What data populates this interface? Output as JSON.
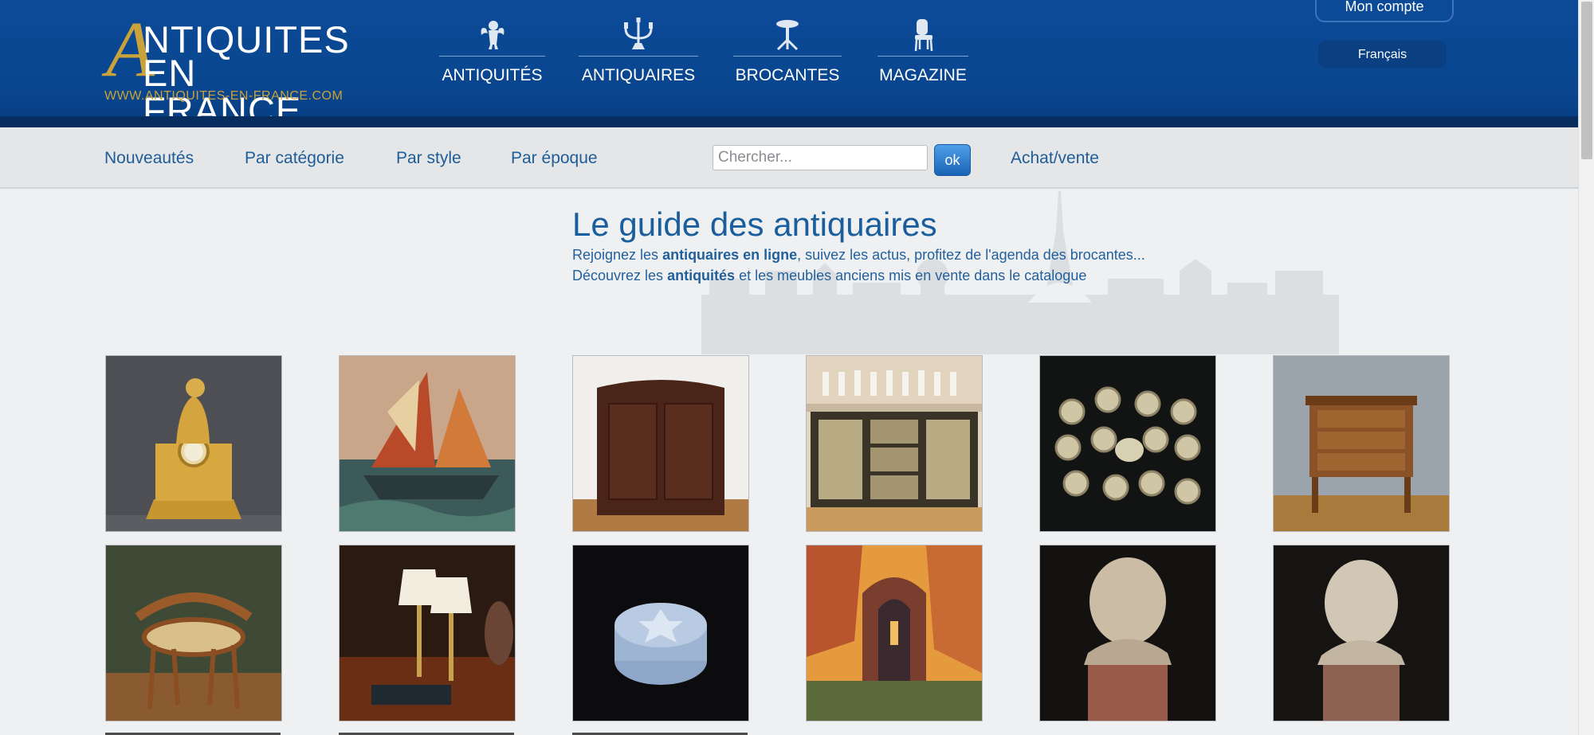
{
  "logo": {
    "big_letter": "A",
    "line1": "NTIQUITES",
    "line2": "EN FRANCE",
    "url": "WWW.ANTIQUITES-EN-FRANCE.COM"
  },
  "main_nav": [
    {
      "label": "ANTIQUITÉS",
      "icon": "cherub-icon"
    },
    {
      "label": "ANTIQUAIRES",
      "icon": "candelabra-icon"
    },
    {
      "label": "BROCANTES",
      "icon": "pedestal-table-icon"
    },
    {
      "label": "MAGAZINE",
      "icon": "chair-icon"
    }
  ],
  "account": {
    "label": "Mon compte"
  },
  "language": {
    "label": "Français"
  },
  "subnav": {
    "links": [
      "Nouveautés",
      "Par catégorie",
      "Par style",
      "Par époque"
    ],
    "search_placeholder": "Chercher...",
    "search_button": "ok",
    "achat_vente": "Achat/vente"
  },
  "hero": {
    "title": "Le guide des antiquaires",
    "line1_pre": "Rejoignez les ",
    "line1_bold": "antiquaires en ligne",
    "line1_post": ", suivez les actus, profitez de l'agenda des brocantes...",
    "line2_pre": "Découvrez les ",
    "line2_bold": "antiquités",
    "line2_post": " et les meubles anciens mis en vente dans le catalogue"
  },
  "colors": {
    "header_blue": "#0c4a98",
    "gold": "#c9a23b",
    "link_blue": "#1f5d99"
  },
  "products": [
    {
      "name": "gilt-bronze-clock"
    },
    {
      "name": "sailboat-painting"
    },
    {
      "name": "walnut-corner-cabinet"
    },
    {
      "name": "crystal-glass-set-on-cabinet"
    },
    {
      "name": "porcelain-tea-service"
    },
    {
      "name": "small-chest-of-drawers"
    },
    {
      "name": "bentwood-cane-armchair"
    },
    {
      "name": "pair-of-table-lamps"
    },
    {
      "name": "glass-powder-box"
    },
    {
      "name": "ruined-abbey-painting"
    },
    {
      "name": "child-bust-sculpture-1"
    },
    {
      "name": "child-bust-sculpture-2"
    }
  ]
}
